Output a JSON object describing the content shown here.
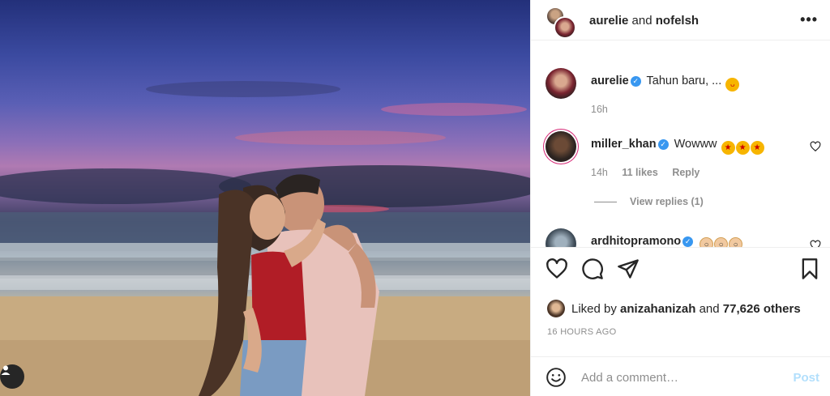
{
  "post": {
    "image_alt": "Couple laughing on a beach at sunset",
    "header": {
      "author_1": "aurelie",
      "connector": "and",
      "author_2": "nofelsh"
    }
  },
  "comments": [
    {
      "username": "aurelie",
      "verified": true,
      "text": "Tahun baru, ...",
      "time": "16h",
      "emoji": [
        "face-with-tongue"
      ]
    },
    {
      "username": "miller_khan",
      "verified": true,
      "text": "Wowww",
      "time": "14h",
      "likes": "11 likes",
      "reply_label": "Reply",
      "view_replies": "View replies (1)",
      "emoji": [
        "star-struck",
        "star-struck",
        "star-struck"
      ]
    },
    {
      "username": "ardhitopramono",
      "verified": true,
      "text": "",
      "emoji": [
        "screaming-face",
        "screaming-face",
        "screaming-face"
      ]
    }
  ],
  "likes": {
    "prefix": "Liked by",
    "user": "anizahanizah",
    "and": "and",
    "count": "77,626 others"
  },
  "timestamp": "16 HOURS AGO",
  "add_comment": {
    "placeholder": "Add a comment…",
    "post_label": "Post"
  },
  "colors": {
    "verified": "#3897f0",
    "post_disabled": "#b2dffc",
    "muted": "#8e8e8e"
  }
}
